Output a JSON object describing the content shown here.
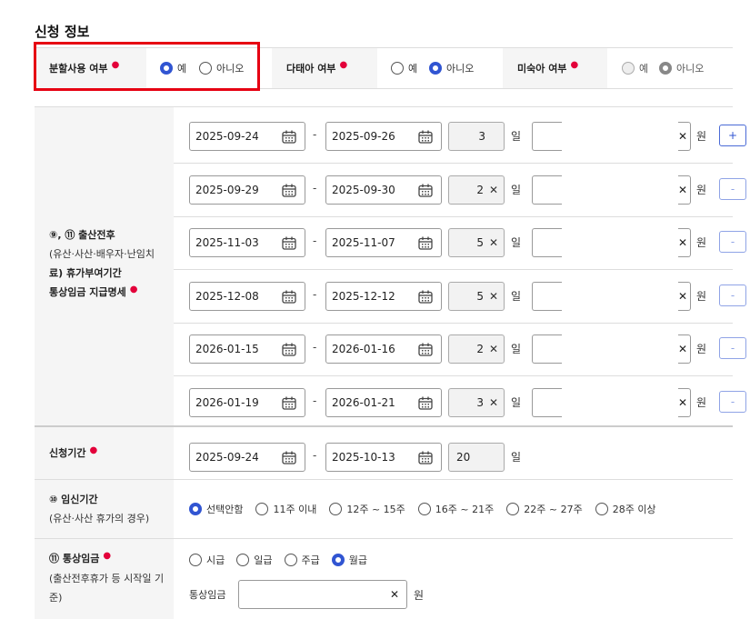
{
  "section_title": "신청 정보",
  "flags": {
    "split_use": {
      "label": "분할사용 여부",
      "options": [
        "예",
        "아니오"
      ],
      "selected": "예"
    },
    "multiple_birth": {
      "label": "다태아 여부",
      "options": [
        "예",
        "아니오"
      ],
      "selected": "아니오"
    },
    "premature": {
      "label": "미숙아 여부",
      "options": [
        "예",
        "아니오"
      ],
      "selected": "아니오",
      "disabled": true
    }
  },
  "periods_section": {
    "label_line1": "⑨, ⑪ 출산전후",
    "label_line2": "(유산·사산·배우자·난임치",
    "label_line3": "료) 휴가부여기간",
    "label_line4": "통상임금 지급명세",
    "separator": "-",
    "day_unit": "일",
    "won_unit": "원",
    "rows": [
      {
        "start": "2025-09-24",
        "end": "2025-09-26",
        "days": "3",
        "clearable": false,
        "button": "+"
      },
      {
        "start": "2025-09-29",
        "end": "2025-09-30",
        "days": "2",
        "clearable": true,
        "button": "-"
      },
      {
        "start": "2025-11-03",
        "end": "2025-11-07",
        "days": "5",
        "clearable": true,
        "button": "-"
      },
      {
        "start": "2025-12-08",
        "end": "2025-12-12",
        "days": "5",
        "clearable": true,
        "button": "-"
      },
      {
        "start": "2026-01-15",
        "end": "2026-01-16",
        "days": "2",
        "clearable": true,
        "button": "-"
      },
      {
        "start": "2026-01-19",
        "end": "2026-01-21",
        "days": "3",
        "clearable": true,
        "button": "-"
      }
    ]
  },
  "application_period": {
    "label": "신청기간",
    "start": "2025-09-24",
    "end": "2025-10-13",
    "days": "20",
    "day_unit": "일"
  },
  "pregnancy_period": {
    "label": "⑩ 임신기간",
    "sub": "(유산·사산 휴가의 경우)",
    "options": [
      "선택안함",
      "11주 이내",
      "12주 ~ 15주",
      "16주 ~ 21주",
      "22주 ~ 27주",
      "28주 이상"
    ],
    "selected": "선택안함"
  },
  "ordinary_wage": {
    "label": "⑪ 통상임금",
    "sub_line1": "(출산전후휴가 등 시작일 기",
    "sub_line2": "준)",
    "options": [
      "시급",
      "일급",
      "주급",
      "월급"
    ],
    "selected": "월급",
    "field_label": "통상임금",
    "unit": "원"
  },
  "colors": {
    "accent": "#3155d2",
    "required": "#e3003a",
    "highlight": "#e60012"
  }
}
